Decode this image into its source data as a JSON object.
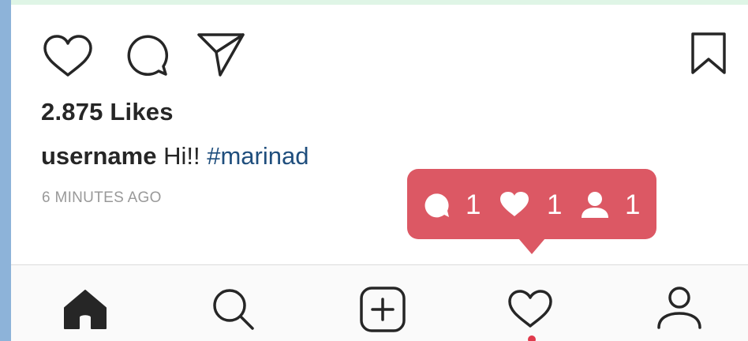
{
  "post": {
    "likes_text": "2.875 Likes",
    "username": "username",
    "caption_text": "Hi!!",
    "hashtag": "#marinad",
    "timestamp": "6 MINUTES AGO"
  },
  "actions": {
    "icons": [
      "heart-icon",
      "comment-icon",
      "send-icon",
      "bookmark-icon"
    ]
  },
  "notification": {
    "comments": "1",
    "likes": "1",
    "follows": "1",
    "color": "#dc5864"
  },
  "tabbar": {
    "tabs": [
      "home-icon",
      "search-icon",
      "add-icon",
      "activity-icon",
      "profile-icon"
    ],
    "active_indicator_color": "#e03a4c"
  }
}
